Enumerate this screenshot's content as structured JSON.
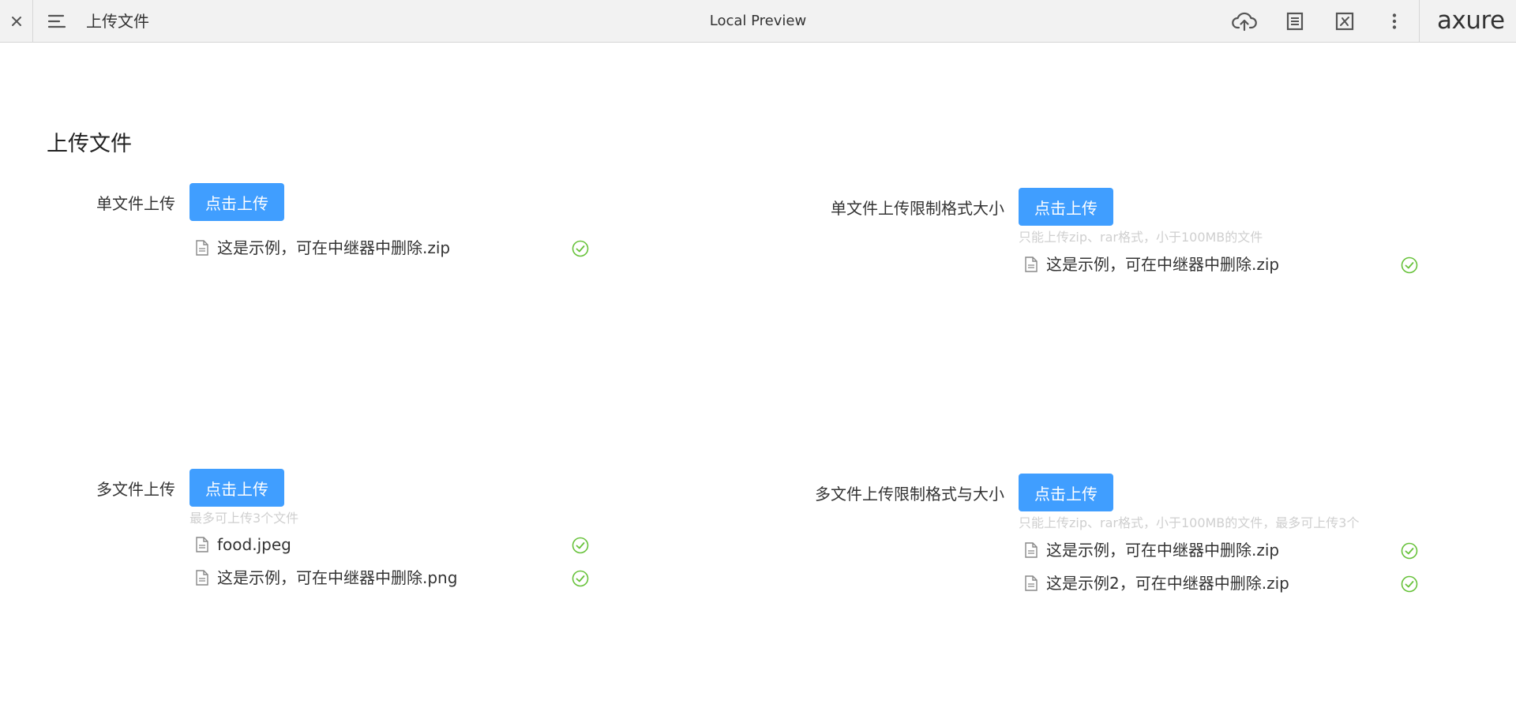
{
  "topbar": {
    "page_title": "上传文件",
    "center_title": "Local Preview",
    "logo": "axure",
    "icons": [
      "close-icon",
      "menu-icon",
      "cloud-upload-icon",
      "notes-icon",
      "variables-icon",
      "more-icon"
    ]
  },
  "main": {
    "heading": "上传文件",
    "button_label": "点击上传",
    "sections": [
      {
        "label": "单文件上传",
        "tip": "",
        "files": [
          {
            "name": "这是示例，可在中继器中删除.zip",
            "status": "success"
          }
        ]
      },
      {
        "label": "单文件上传限制格式大小",
        "tip": "只能上传zip、rar格式，小于100MB的文件",
        "files": [
          {
            "name": "这是示例，可在中继器中删除.zip",
            "status": "success"
          }
        ]
      },
      {
        "label": "多文件上传",
        "tip": "最多可上传3个文件",
        "files": [
          {
            "name": "food.jpeg",
            "status": "success"
          },
          {
            "name": "这是示例，可在中继器中删除.png",
            "status": "success"
          }
        ]
      },
      {
        "label": "多文件上传限制格式与大小",
        "tip": "只能上传zip、rar格式，小于100MB的文件，最多可上传3个",
        "files": [
          {
            "name": "这是示例，可在中继器中删除.zip",
            "status": "success"
          },
          {
            "name": "这是示例2，可在中继器中删除.zip",
            "status": "success"
          }
        ]
      }
    ]
  },
  "colors": {
    "accent": "#409eff",
    "success": "#67c23a",
    "tip": "#cfcfcf",
    "topbar_bg": "#f2f2f2"
  }
}
